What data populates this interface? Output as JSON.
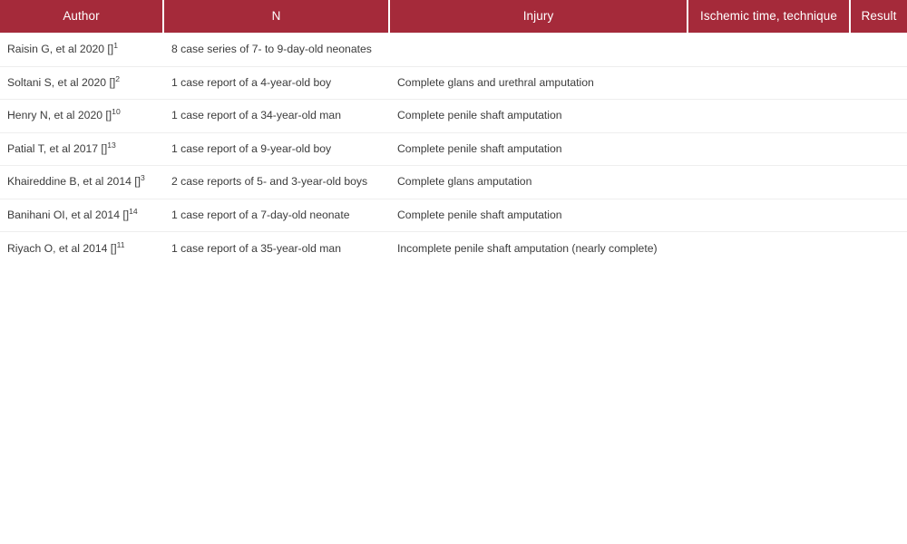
{
  "table": {
    "columns": [
      {
        "key": "author",
        "label": "Author"
      },
      {
        "key": "n",
        "label": "N"
      },
      {
        "key": "injury",
        "label": "Injury"
      },
      {
        "key": "ischemic",
        "label": "Ischemic time, technique"
      },
      {
        "key": "result",
        "label": "Result"
      }
    ],
    "header_background": "#a52a3a",
    "header_text_color": "#ffffff",
    "row_separator_color": "#eeeeee",
    "body_text_color": "#3b3b3b",
    "rows": [
      {
        "author_text": "Raisin G, et al 2020 []",
        "author_ref": "1",
        "n": "8 case series of 7- to 9-day-old neonates",
        "injury": "",
        "ischemic": "",
        "result": ""
      },
      {
        "author_text": "Soltani S, et al 2020 []",
        "author_ref": "2",
        "n": "1 case report of a 4-year-old boy",
        "injury": "Complete glans and urethral amputation",
        "ischemic": "",
        "result": ""
      },
      {
        "author_text": "Henry N, et al 2020 []",
        "author_ref": "10",
        "n": "1 case report of a 34-year-old man",
        "injury": "Complete penile shaft amputation",
        "ischemic": "",
        "result": ""
      },
      {
        "author_text": "Patial T, et al 2017 []",
        "author_ref": "13",
        "n": "1 case report of a 9-year-old boy",
        "injury": "Complete penile shaft amputation",
        "ischemic": "",
        "result": ""
      },
      {
        "author_text": "Khaireddine B, et al 2014 []",
        "author_ref": "3",
        "n": "2 case reports of 5- and 3-year-old boys",
        "injury": "Complete glans amputation",
        "ischemic": "",
        "result": ""
      },
      {
        "author_text": "Banihani OI, et al 2014 []",
        "author_ref": "14",
        "n": "1 case report of a 7-day-old neonate",
        "injury": "Complete penile shaft amputation",
        "ischemic": "",
        "result": ""
      },
      {
        "author_text": "Riyach O, et al 2014 []",
        "author_ref": "11",
        "n": "1 case report of a 35-year-old man",
        "injury": "Incomplete penile shaft amputation (nearly complete)",
        "ischemic": "",
        "result": ""
      }
    ]
  }
}
